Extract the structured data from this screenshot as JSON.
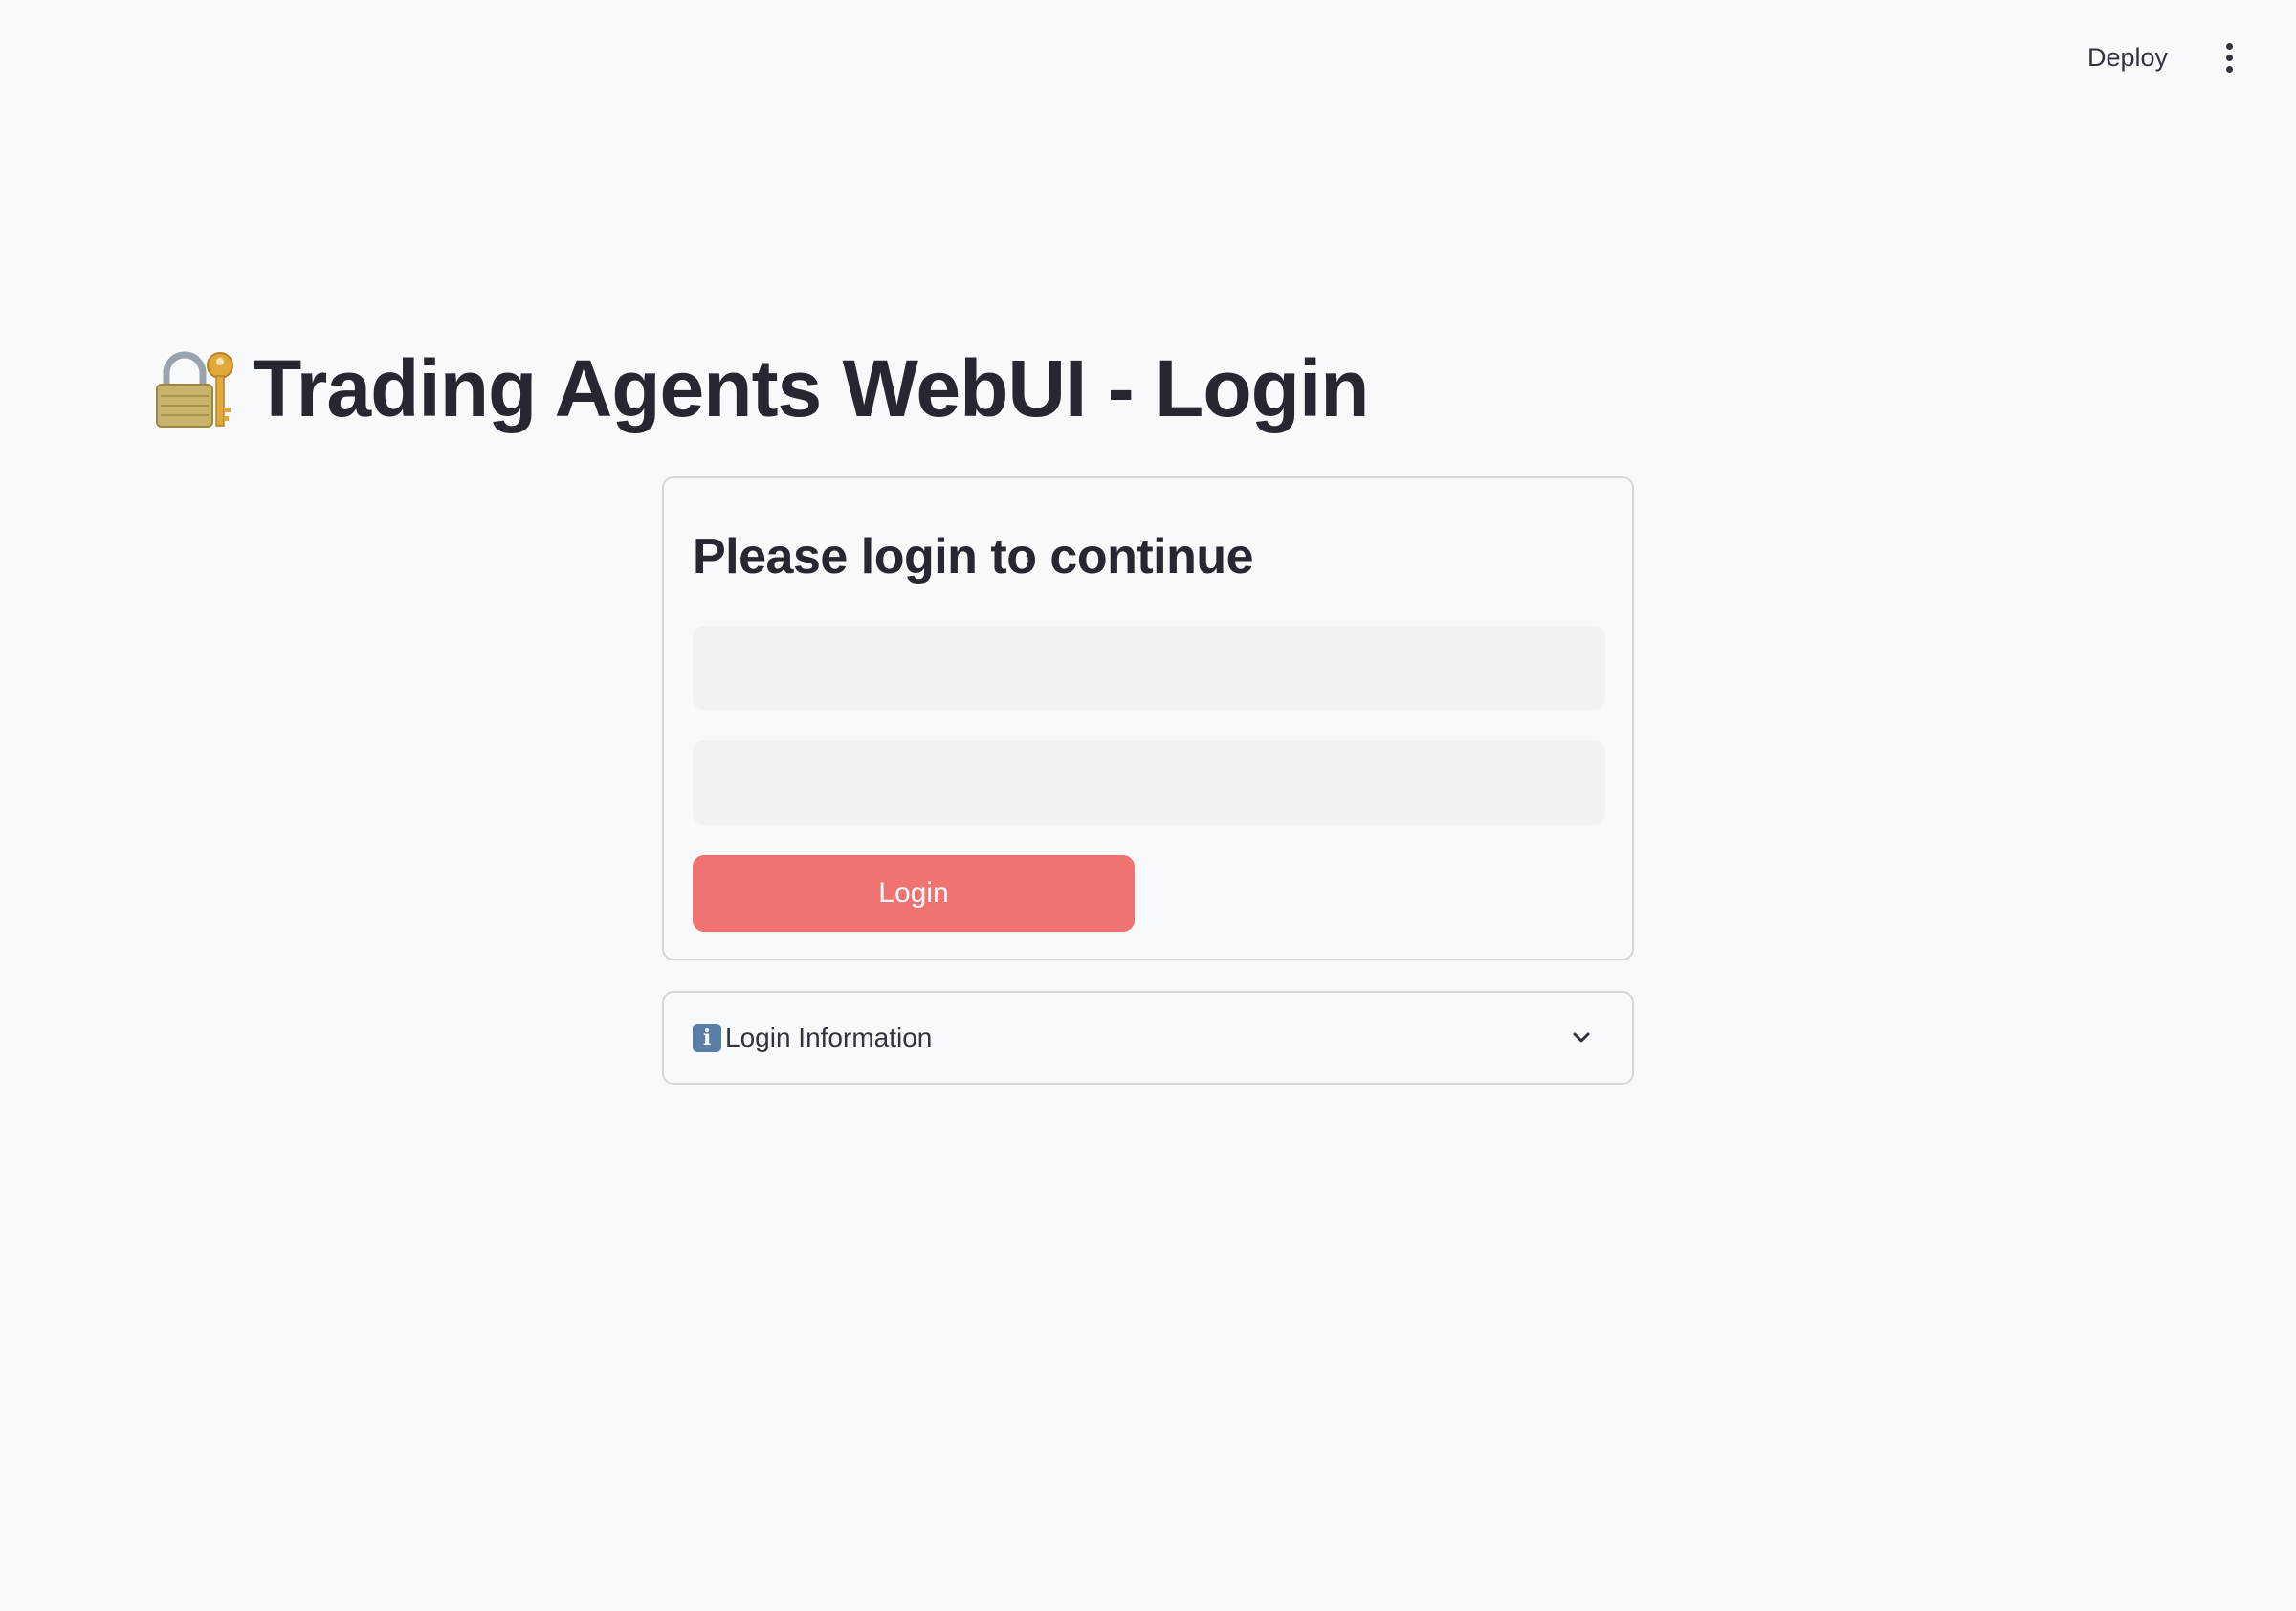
{
  "header": {
    "deploy_label": "Deploy",
    "menu_icon": "more-vertical-icon"
  },
  "page": {
    "title": "Trading Agents WebUI - Login",
    "title_icon": "lock-with-key-icon"
  },
  "login_form": {
    "heading": "Please login to continue",
    "username": {
      "value": "",
      "placeholder": ""
    },
    "password": {
      "value": "",
      "placeholder": ""
    },
    "submit_label": "Login",
    "button_color": "#ef7370"
  },
  "expander": {
    "icon": "info-icon",
    "icon_glyph": "i",
    "label": "Login Information",
    "chevron_icon": "chevron-down-icon",
    "expanded": false
  }
}
